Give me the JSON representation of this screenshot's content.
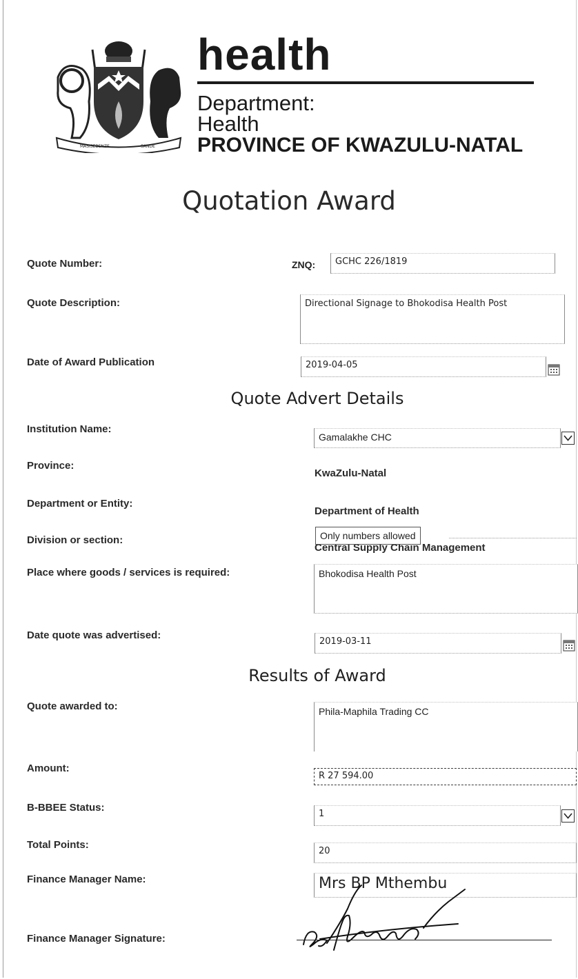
{
  "header": {
    "title": "health",
    "department_line1": "Department:",
    "department_line2": "Health",
    "province": "PROVINCE OF KWAZULU-NATAL"
  },
  "document": {
    "title": "Quotation Award"
  },
  "quote": {
    "number_label": "Quote Number:",
    "number_prefix": "ZNQ:",
    "number_value": "GCHC 226/1819",
    "description_label": "Quote Description:",
    "description_value": "Directional Signage to Bhokodisa Health Post",
    "award_date_label": "Date of Award Publication",
    "award_date_value": "2019-04-05"
  },
  "advert": {
    "section_title": "Quote Advert Details",
    "institution_label": "Institution Name:",
    "institution_value": "Gamalakhe CHC",
    "province_label": "Province:",
    "province_value": "KwaZulu-Natal",
    "department_label": "Department or Entity:",
    "department_value": "Department of Health",
    "division_label": "Division or section:",
    "division_value": "Central Supply Chain Management",
    "place_label": "Place where goods /  services is required:",
    "place_value": "Bhokodisa Health Post",
    "advertised_label": "Date quote was advertised:",
    "advertised_value": "2019-03-11"
  },
  "results": {
    "section_title": "Results of Award",
    "awarded_label": "Quote awarded to:",
    "awarded_value": "Phila-Maphila Trading CC",
    "tooltip": "Only numbers allowed",
    "amount_label": "Amount:",
    "amount_value": "R 27 594.00",
    "bbbee_label": "B-BBEE Status:",
    "bbbee_value": "1",
    "points_label": "Total Points:",
    "points_value": "20",
    "manager_label": "Finance Manager Name:",
    "manager_value": "Mrs BP Mthembu",
    "signature_label": "Finance Manager Signature:"
  },
  "icons": {
    "crest": "coat-of-arms-icon",
    "dropdown": "dropdown-arrow-icon",
    "calendar": "calendar-icon"
  }
}
